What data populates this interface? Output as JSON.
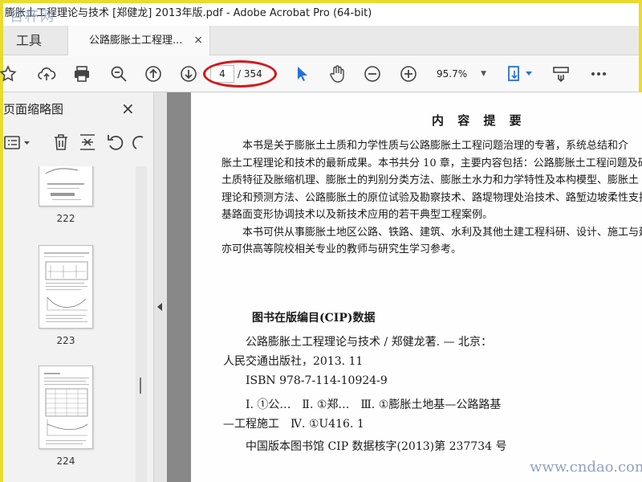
{
  "window": {
    "title": "膨胀土工程理论与技术 [郑健龙] 2013年版.pdf - Adobe Acrobat Pro (64-bit)",
    "watermark_top": "百杯网",
    "watermark_bottom": "www.cndao.com"
  },
  "tabs": {
    "tools": "工具",
    "document": "公路膨胀土工程理...",
    "close": "×"
  },
  "toolbar": {
    "page_current": "4",
    "page_total": "/ 354",
    "zoom": "95.7%",
    "icons": [
      "star-icon",
      "cloud-upload-icon",
      "print-icon",
      "zoom-out-search-icon",
      "arrow-up-circle-icon",
      "arrow-down-circle-icon",
      "select-arrow-icon",
      "hand-icon",
      "minus-circle-icon",
      "plus-circle-icon",
      "fit-page-icon",
      "scroll-mode-icon",
      "more-icon"
    ],
    "accent": "#2a6fd6",
    "annotation_color": "#d0191a"
  },
  "left_panel": {
    "title": "页面缩略图",
    "close": "×",
    "thumbnails": [
      {
        "label": "222"
      },
      {
        "label": "223"
      },
      {
        "label": "224"
      }
    ]
  },
  "document": {
    "heading": "内 容 提 要",
    "paragraph_lines": [
      "　　本书是关于膨胀土土质和力学性质与公路膨胀土工程问题治理的专著，系统总结和介",
      "胀土工程理论和技术的最新成果。本书共分 10 章，主要内容包括：公路膨胀土工程问题及研",
      "土质特征及胀缩机理、膨胀土的判别分类方法、膨胀土水力和力学特性及本构模型、膨胀土",
      "理论和预测方法、公路膨胀土的原位试验及勘察技术、路堤物理处治技术、路堑边坡柔性支挡",
      "基路面变形协调技术以及新技术应用的若干典型工程案例。",
      "　　本书可供从事膨胀土地区公路、铁路、建筑、水利及其他土建工程科研、设计、施工与建设",
      "亦可供高等院校相关专业的教师与研究生学习参考。"
    ],
    "cip_title": "图书在版编目(CIP)数据",
    "cip_lines": [
      "　　公路膨胀土工程理论与技术 / 郑健龙著. — 北京：",
      "人民交通出版社，2013. 11",
      "　　ISBN  978-7-114-10924-9",
      "　　Ⅰ. ①公…　Ⅱ. ①郑…　Ⅲ. ①膨胀土地基—公路路基",
      "—工程施工　Ⅳ. ①U416. 1",
      "　　中国版本图书馆 CIP 数据核字(2013)第 237734 号"
    ]
  }
}
